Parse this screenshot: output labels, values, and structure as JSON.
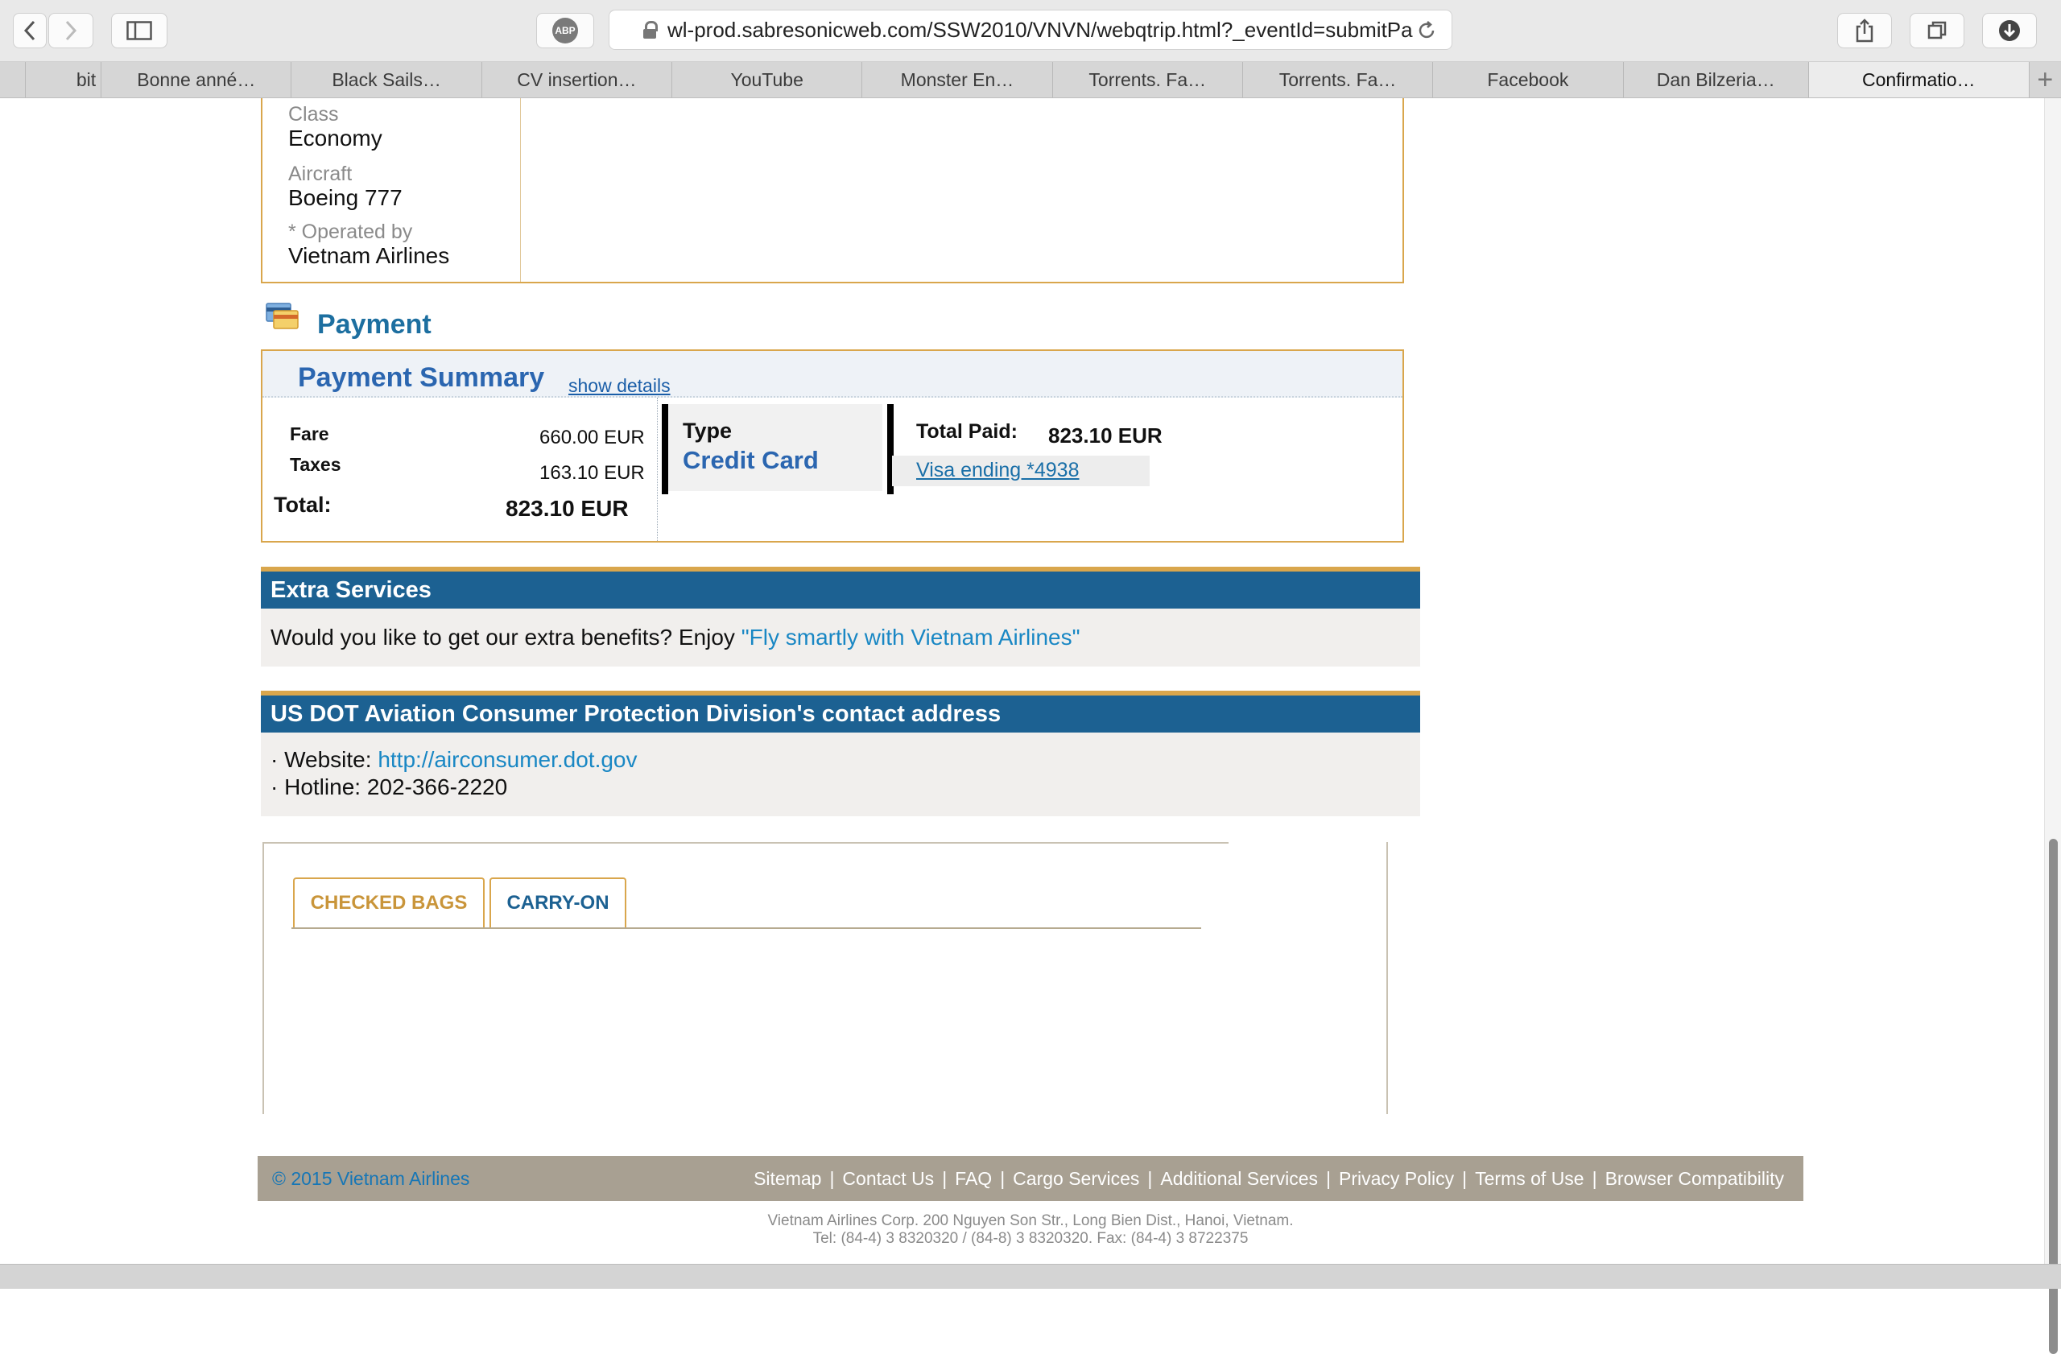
{
  "browser": {
    "url": "wl-prod.sabresonicweb.com/SSW2010/VNVN/webqtrip.html?_eventId=submitPa",
    "adblock_label": "ABP",
    "tabs": [
      "",
      "bit",
      "Bonne anné…",
      "Black Sails…",
      "CV insertion…",
      "YouTube",
      "Monster En…",
      "Torrents. Fa…",
      "Torrents. Fa…",
      "Facebook",
      "Dan Bilzeria…",
      "Confirmatio…"
    ],
    "new_tab": "+"
  },
  "flight": {
    "class_label": "Class",
    "class_value": "Economy",
    "aircraft_label": "Aircraft",
    "aircraft_value": "Boeing 777",
    "operated_label": "* Operated by",
    "operated_value": "Vietnam Airlines"
  },
  "payment": {
    "section_title": "Payment",
    "summary_title": "Payment Summary",
    "show_details": "show details",
    "fare_label": "Fare",
    "fare_value": "660.00 EUR",
    "taxes_label": "Taxes",
    "taxes_value": "163.10 EUR",
    "total_label": "Total:",
    "total_value": "823.10 EUR",
    "type_label": "Type",
    "type_value": "Credit Card",
    "total_paid_label": "Total Paid:",
    "total_paid_value": "823.10 EUR",
    "card_link": "Visa ending *4938"
  },
  "extra_services": {
    "title": "Extra Services",
    "text": "Would you like to get our extra benefits? Enjoy ",
    "link": "\"Fly smartly with Vietnam Airlines\""
  },
  "dot": {
    "title": "US DOT Aviation Consumer Protection Division's contact address",
    "website_label": "· Website: ",
    "website_link": "http://airconsumer.dot.gov",
    "hotline": "· Hotline: 202-366-2220"
  },
  "baggage": {
    "tab_checked": "CHECKED BAGS",
    "tab_carry": "CARRY-ON"
  },
  "footer": {
    "copyright": "© 2015 Vietnam Airlines",
    "links": [
      "Sitemap",
      "Contact Us",
      "FAQ",
      "Cargo Services",
      "Additional Services",
      "Privacy Policy",
      "Terms of Use",
      "Browser Compatibility"
    ],
    "address_line1": "Vietnam Airlines Corp. 200 Nguyen Son Str., Long Bien Dist., Hanoi, Vietnam.",
    "address_line2": "Tel: (84-4) 3 8320320 / (84-8) 3 8320320. Fax: (84-4) 3 8722375"
  },
  "colors": {
    "gold": "#d9a64c",
    "section_blue": "#1c6192",
    "link_blue": "#1987c4",
    "footer_bg": "#a8a092"
  }
}
